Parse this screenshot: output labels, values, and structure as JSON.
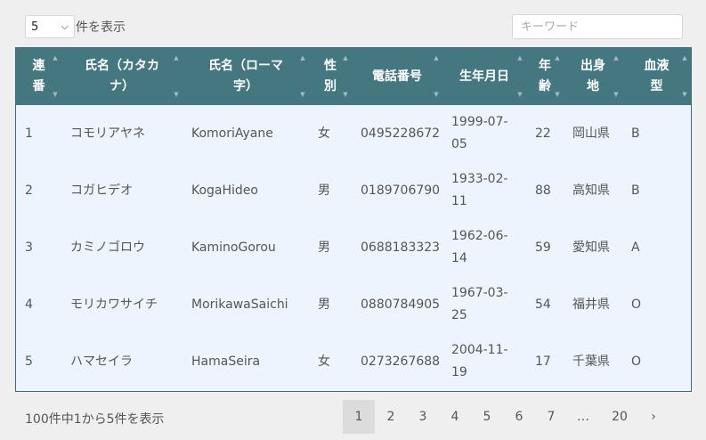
{
  "controls": {
    "page_size_value": "5",
    "page_size_label": "件を表示",
    "search_placeholder": "キーワード"
  },
  "table": {
    "columns": [
      {
        "line1": "連",
        "line2": "番"
      },
      {
        "line1": "氏名（カタカ",
        "line2": "ナ）"
      },
      {
        "line1": "氏名（ローマ",
        "line2": "字）"
      },
      {
        "line1": "性",
        "line2": "別"
      },
      {
        "line1": "電話番号",
        "line2": ""
      },
      {
        "line1": "生年月日",
        "line2": ""
      },
      {
        "line1": "年",
        "line2": "齢"
      },
      {
        "line1": "出身",
        "line2": "地"
      },
      {
        "line1": "血液",
        "line2": "型"
      }
    ],
    "rows": [
      {
        "no": "1",
        "kana": "コモリアヤネ",
        "roman": "KomoriAyane",
        "gender": "女",
        "phone": "0495228672",
        "birth1": "1999-07-",
        "birth2": "05",
        "age": "22",
        "pref": "岡山県",
        "blood": "B"
      },
      {
        "no": "2",
        "kana": "コガヒデオ",
        "roman": "KogaHideo",
        "gender": "男",
        "phone": "0189706790",
        "birth1": "1933-02-",
        "birth2": "11",
        "age": "88",
        "pref": "高知県",
        "blood": "B"
      },
      {
        "no": "3",
        "kana": "カミノゴロウ",
        "roman": "KaminoGorou",
        "gender": "男",
        "phone": "0688183323",
        "birth1": "1962-06-",
        "birth2": "14",
        "age": "59",
        "pref": "愛知県",
        "blood": "A"
      },
      {
        "no": "4",
        "kana": "モリカワサイチ",
        "roman": "MorikawaSaichi",
        "gender": "男",
        "phone": "0880784905",
        "birth1": "1967-03-",
        "birth2": "25",
        "age": "54",
        "pref": "福井県",
        "blood": "O"
      },
      {
        "no": "5",
        "kana": "ハマセイラ",
        "roman": "HamaSeira",
        "gender": "女",
        "phone": "0273267688",
        "birth1": "2004-11-",
        "birth2": "19",
        "age": "17",
        "pref": "千葉県",
        "blood": "O"
      }
    ]
  },
  "footer": {
    "info": "100件中1から5件を表示",
    "pages": [
      "1",
      "2",
      "3",
      "4",
      "5",
      "6",
      "7",
      "…",
      "20"
    ],
    "active_page": "1",
    "next": "›"
  },
  "colors": {
    "header_bg": "#457780",
    "body_bg": "#eef4fd",
    "active_page_bg": "#dcdcdc"
  }
}
